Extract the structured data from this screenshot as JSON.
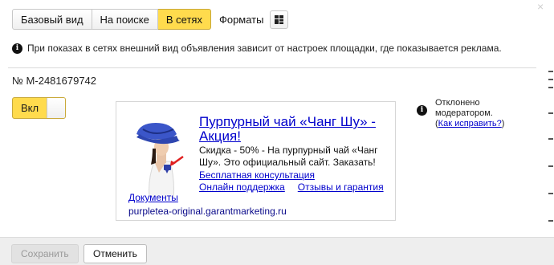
{
  "tabs": [
    {
      "label": "Базовый вид",
      "active": false
    },
    {
      "label": "На поиске",
      "active": false
    },
    {
      "label": "В сетях",
      "active": true
    }
  ],
  "formats_label": "Форматы",
  "info_message": "При показах в сетях внешний вид объявления зависит от настроек площадки, где показывается реклама.",
  "ad_number": "№ M-2481679742",
  "toggle": {
    "label": "Вкл",
    "on": true
  },
  "ad": {
    "title": "Пурпурный чай «Чанг Шу» - Акция!",
    "text": "Скидка - 50% - На пурпурный чай «Чанг Шу». Это официальный сайт. Заказать!",
    "sitelinks": [
      "Бесплатная консультация",
      "Онлайн поддержка",
      "Отзывы и гарантия"
    ],
    "docs_link": "Документы",
    "display_url": "purpletea-original.garantmarketing.ru"
  },
  "status": {
    "line1": "Отклонено",
    "line2": "модератором.",
    "fix_link": "Как исправить?",
    "open_paren": "(",
    "close_paren": ")"
  },
  "footer": {
    "save_label": "Сохранить",
    "cancel_label": "Отменить"
  },
  "colors": {
    "accent": "#ffdb4d",
    "link": "#0000cc",
    "hat": "#3b56c9"
  },
  "icons": {
    "close": "×",
    "info": "i"
  }
}
